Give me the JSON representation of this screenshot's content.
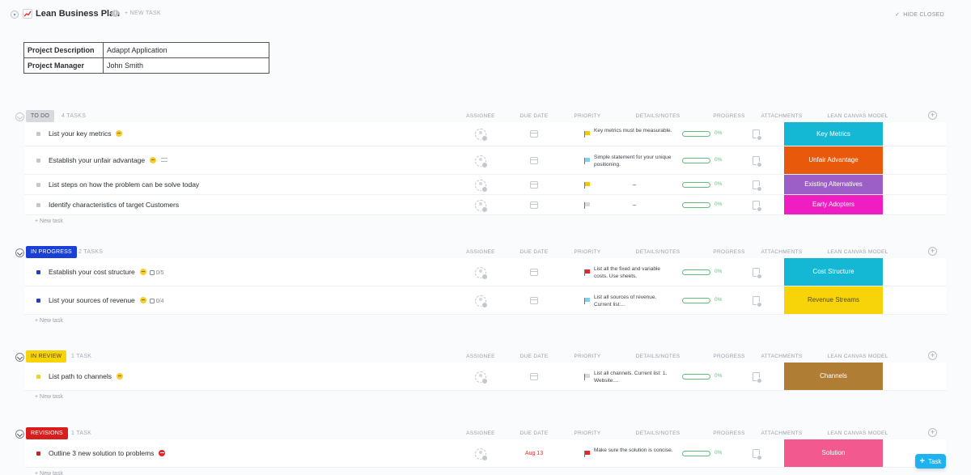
{
  "header": {
    "title": "Lean Business Plan",
    "new_task": "+ NEW TASK",
    "hide_closed": "HIDE CLOSED",
    "hide_closed_check": "✓"
  },
  "info": [
    {
      "key": "Project Description",
      "value": "Adappt Application"
    },
    {
      "key": "Project Manager",
      "value": "John Smith"
    }
  ],
  "columns": {
    "assignee": "ASSIGNEE",
    "due_date": "DUE DATE",
    "priority": "PRIORITY",
    "details": "DETAILS/NOTES",
    "progress": "PROGRESS",
    "attachments": "ATTACHMENTS",
    "lean_canvas": "LEAN CANVAS MODEL"
  },
  "groups": [
    {
      "status": "TO DO",
      "status_color": "#d7d9dd",
      "status_text_color": "#555a63",
      "count": "4 TASKS",
      "new_task": "+ New task",
      "tasks": [
        {
          "name": "List your key metrics",
          "emoji": "yellow",
          "priority": "#f7c600",
          "notes": "Key metrics must be measurable.",
          "progress": "0%",
          "canvas": "Key Metrics",
          "canvas_color": "#14b7d4"
        },
        {
          "name": "Establish your unfair advantage",
          "emoji": "yellow",
          "comment": true,
          "priority": "#7fd0ea",
          "notes": "Simple statement for your unique positioning.",
          "progress": "0%",
          "canvas": "Unfair Advantage",
          "canvas_color": "#e8590c"
        },
        {
          "name": "List steps on how the problem can be solve today",
          "priority": "#f7c600",
          "notes": "–",
          "progress": "0%",
          "canvas": "Existing Alternatives",
          "canvas_color": "#9c5fc7"
        },
        {
          "name": "Identify characteristics of target Customers",
          "priority": "#d5d8de",
          "notes": "–",
          "progress": "0%",
          "canvas": "Early Adopters",
          "canvas_color": "#ee1ec3"
        }
      ]
    },
    {
      "status": "IN PROGRESS",
      "status_color": "#1a3fd6",
      "status_text_color": "#ffffff",
      "count": "2 TASKS",
      "new_task": "+ New task",
      "tasks": [
        {
          "name": "Establish your cost structure",
          "emoji": "yellow",
          "subtasks": "0/5",
          "priority": "#e5252a",
          "notes": "List all the fixed and variable costs. Use sheets.",
          "progress": "0%",
          "canvas": "Cost Structure",
          "canvas_color": "#14b7d4"
        },
        {
          "name": "List your sources of revenue",
          "emoji": "yellow",
          "subtasks": "0/4",
          "priority": "#7fd0ea",
          "notes": "List all sources of revenue. Current list:...",
          "progress": "0%",
          "canvas": "Revenue Streams",
          "canvas_color": "#f7d40a",
          "canvas_text": "#5a4a00"
        }
      ]
    },
    {
      "status": "IN REVIEW",
      "status_color": "#f7d40a",
      "status_text_color": "#5a4a00",
      "count": "1 TASK",
      "new_task": "+ New task",
      "tasks": [
        {
          "name": "List path to channels",
          "emoji": "yellow",
          "priority": "#d5d8de",
          "notes": "List all channels. Current list: 1. Website....",
          "progress": "0%",
          "canvas": "Channels",
          "canvas_color": "#b07d35"
        }
      ]
    },
    {
      "status": "REVISIONS",
      "status_color": "#d91c1c",
      "status_text_color": "#ffffff",
      "count": "1 TASK",
      "new_task": "+ New task",
      "tasks": [
        {
          "name": "Outline 3 new solution to problems",
          "emoji": "red",
          "due": "Aug 13",
          "priority": "#e5252a",
          "notes": "Make sure the solution is concise.",
          "progress": "0%",
          "canvas": "Solution",
          "canvas_color": "#f25a8f"
        }
      ]
    }
  ],
  "fab": {
    "plus": "+",
    "label": "Task"
  }
}
